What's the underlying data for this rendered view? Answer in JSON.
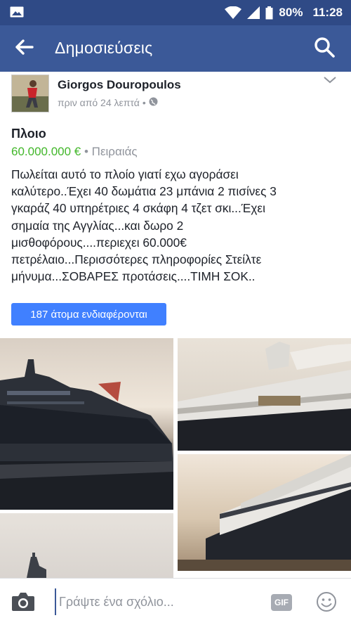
{
  "status_bar": {
    "battery": "80%",
    "time": "11:28"
  },
  "app_bar": {
    "title": "Δημοσιεύσεις"
  },
  "post": {
    "author": "Giorgos Douropoulos",
    "time_ago": "πριν από 24 λεπτά",
    "separator": "•",
    "item_title": "Πλοιο",
    "price": "60.000.000 €",
    "location": "• Πειραιάς",
    "description": "Πωλείται αυτό το πλοίο γιατί εχω αγοράσει\nκαλύτερο..Έχει 40 δωμάτια 23 μπάνια 2 πισίνες 3\nγκαράζ 40 υπηρέτριες 4 σκάφη 4 τζετ σκι...Έχει\nσημαία της Αγγλίας...και δωρο 2\nμισθοφόρους....περιεχει 60.000€\nπετρέλαιο...Περισσότερες πληροφορίες Στείλτε\nμήνυμα...ΣΟΒΑΡΕΣ προτάσεις....ΤΙΜΗ ΣΟΚ..",
    "interested_button": "187 άτομα ενδιαφέρονται"
  },
  "comment_bar": {
    "placeholder": "Γράψτε ένα σχόλιο...",
    "gif_label": "GIF"
  },
  "colors": {
    "status_bar": "#2f4a86",
    "app_bar": "#3b5998",
    "price": "#42b72a",
    "button": "#4080ff",
    "muted_text": "#90949c"
  },
  "icons": [
    "image-icon",
    "wifi-icon",
    "signal-icon",
    "battery-icon",
    "back-arrow-icon",
    "search-icon",
    "globe-icon",
    "chevron-down-icon",
    "camera-icon",
    "gif-icon",
    "emoji-icon"
  ]
}
